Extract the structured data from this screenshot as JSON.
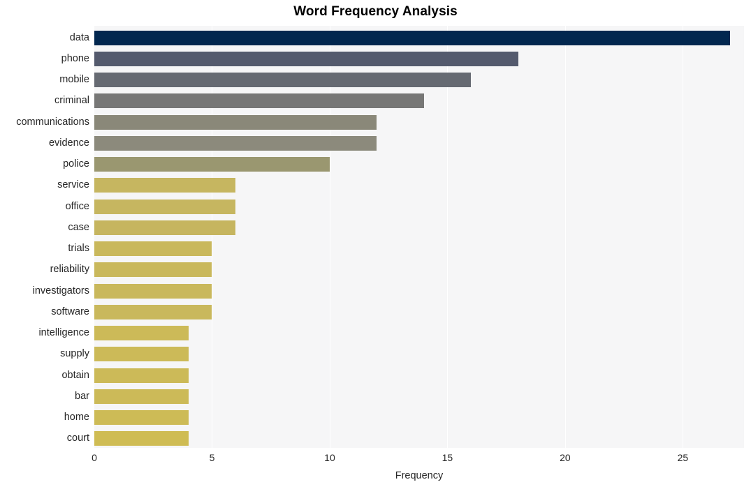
{
  "chart_data": {
    "type": "bar",
    "orientation": "horizontal",
    "title": "Word Frequency Analysis",
    "xlabel": "Frequency",
    "ylabel": "",
    "xlim": [
      0,
      27.6
    ],
    "ylim": null,
    "grid": "vertical-only",
    "legend": null,
    "xticks": [
      0,
      5,
      10,
      15,
      20,
      25
    ],
    "xtick_labels": [
      "0",
      "5",
      "10",
      "15",
      "20",
      "25"
    ],
    "categories": [
      "data",
      "phone",
      "mobile",
      "criminal",
      "communications",
      "evidence",
      "police",
      "service",
      "office",
      "case",
      "trials",
      "reliability",
      "investigators",
      "software",
      "intelligence",
      "supply",
      "obtain",
      "bar",
      "home",
      "court"
    ],
    "values": [
      27,
      18,
      16,
      14,
      12,
      12,
      10,
      6,
      6,
      6,
      5,
      5,
      5,
      5,
      4,
      4,
      4,
      4,
      4,
      4
    ],
    "bar_colors": [
      "#02274f",
      "#545a6d",
      "#666a72",
      "#777776",
      "#8a8879",
      "#8c8a7c",
      "#9a9770",
      "#c6b660",
      "#c6b660",
      "#c6b55f",
      "#c9b85c",
      "#c9b85c",
      "#c9b85c",
      "#c9b85c",
      "#ccba58",
      "#ccba58",
      "#ccba58",
      "#ccba58",
      "#cdbb56",
      "#cfbc54"
    ],
    "plot_background": "#f6f6f7",
    "figure_background": "#ffffff",
    "gridline_color": "#ffffff",
    "text_color": "#262626"
  }
}
